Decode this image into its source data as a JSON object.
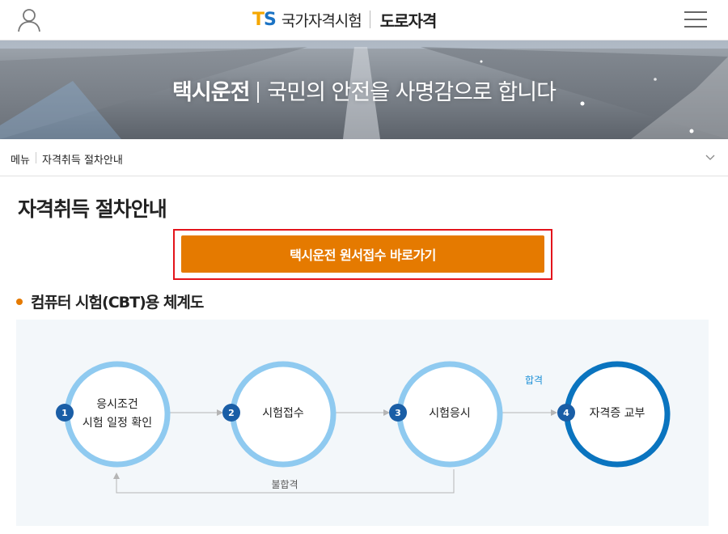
{
  "header": {
    "logo_t": "T",
    "logo_s": "S",
    "logo_org": "국가자격시험",
    "logo_sub": "도로자격",
    "user_icon": "user-icon",
    "menu_icon": "hamburger-menu-icon"
  },
  "banner": {
    "strong": "택시운전",
    "slogan": "국민의 안전을 사명감으로 합니다"
  },
  "breadcrumb": {
    "menu_label": "메뉴",
    "current": "자격취득 절차안내"
  },
  "page": {
    "title": "자격취득 절차안내",
    "apply_button": "택시운전 원서접수 바로가기",
    "section_title": "컴퓨터 시험(CBT)용 체계도"
  },
  "flow": {
    "steps": [
      {
        "num": "1",
        "lines": [
          "응시조건",
          "시험 일정 확인"
        ]
      },
      {
        "num": "2",
        "lines": [
          "시험접수"
        ]
      },
      {
        "num": "3",
        "lines": [
          "시험응시"
        ]
      },
      {
        "num": "4",
        "lines": [
          "자격증 교부"
        ]
      }
    ],
    "pass_label": "합격",
    "fail_label": "불합격"
  },
  "colors": {
    "accent_orange": "#e57a00",
    "highlight_red": "#e3141b",
    "ring_light_blue": "#8fcaf0",
    "ring_dark_blue": "#0a74bf",
    "badge_blue": "#1a5ea6"
  }
}
